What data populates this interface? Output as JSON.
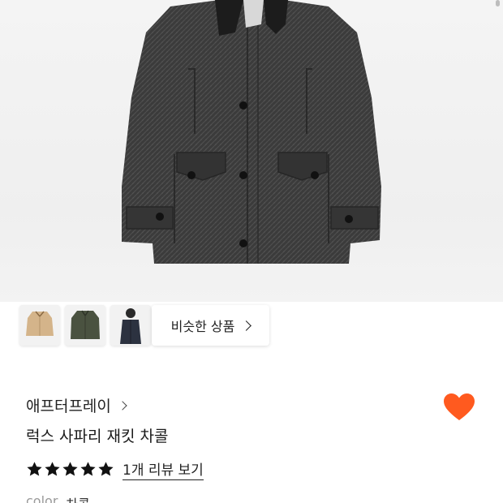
{
  "gallery": {
    "thumbnails": [
      {
        "name": "beige-jacket",
        "color": "#d4b48a"
      },
      {
        "name": "olive-jacket",
        "color": "#4a5240"
      },
      {
        "name": "navy-coat-model",
        "color": "#2c3240"
      }
    ],
    "similar_label": "비슷한 상품"
  },
  "product": {
    "brand": "애프터프레이",
    "name": "럭스 사파리 재킷 차콜",
    "rating": 5,
    "review_link": "1개 리뷰 보기",
    "color_label": "color",
    "color_value": "차콜"
  },
  "colors": {
    "accent": "#ff5a1f",
    "star": "#111111",
    "jacket": "#3a3a3a"
  }
}
